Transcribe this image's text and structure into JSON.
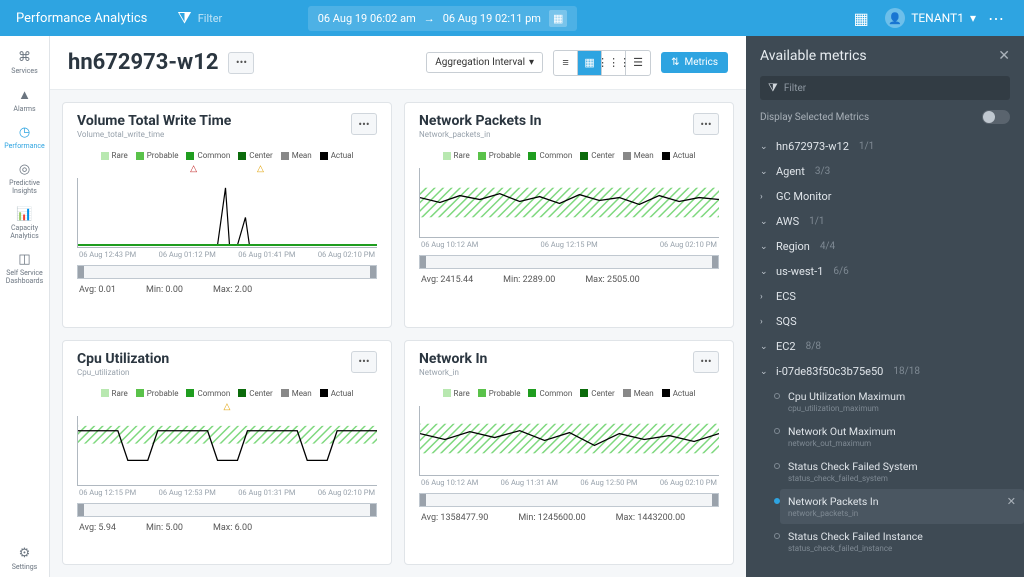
{
  "app": {
    "title": "Performance Analytics"
  },
  "topbar": {
    "filter_placeholder": "Filter",
    "date_from": "06 Aug 19 06:02 am",
    "date_to": "06 Aug 19 02:11 pm",
    "tenant": "TENANT1"
  },
  "sidebar": {
    "items": [
      {
        "label": "Services",
        "icon": "⌘"
      },
      {
        "label": "Alarms",
        "icon": "▲"
      },
      {
        "label": "Performance",
        "icon": "◷",
        "selected": true
      },
      {
        "label": "Predictive Insights",
        "icon": "◎"
      },
      {
        "label": "Capacity Analytics",
        "icon": "📊"
      },
      {
        "label": "Self Service Dashboards",
        "icon": "◫"
      }
    ],
    "settings_label": "Settings"
  },
  "titlebar": {
    "host": "hn672973-w12",
    "agg_label": "Aggregation Interval",
    "metrics_btn": "Metrics"
  },
  "legend": {
    "rare": "Rare",
    "probable": "Probable",
    "common": "Common",
    "center": "Center",
    "mean": "Mean",
    "actual": "Actual"
  },
  "cards": [
    {
      "title": "Volume Total Write Time",
      "subtitle": "Volume_total_write_time",
      "xticks": [
        "06 Aug 12:43 PM",
        "06 Aug 01:12 PM",
        "06 Aug 01:41 PM",
        "06 Aug 02:10 PM"
      ],
      "stats": {
        "avg": "0.01",
        "min": "0.00",
        "max": "2.00"
      },
      "chart_data": {
        "type": "line",
        "xlabel": "",
        "ylabel": "",
        "x": [
          "06 Aug 12:43 PM",
          "06 Aug 01:12 PM",
          "06 Aug 01:41 PM",
          "06 Aug 02:10 PM"
        ],
        "yticks": [
          1,
          2,
          3
        ],
        "series": [
          {
            "name": "Actual",
            "values": [
              0,
              0,
              2,
              0,
              0.9,
              0,
              0,
              0,
              0
            ]
          }
        ]
      }
    },
    {
      "title": "Network Packets In",
      "subtitle": "Network_packets_in",
      "xticks": [
        "06 Aug 10:12 AM",
        "06 Aug 12:15 PM",
        "06 Aug 02:10 PM"
      ],
      "stats": {
        "avg": "2415.44",
        "min": "2289.00",
        "max": "2505.00"
      },
      "chart_data": {
        "type": "line-band",
        "xlabel": "",
        "ylabel": "",
        "x": [
          "06 Aug 10:12 AM",
          "06 Aug 12:15 PM",
          "06 Aug 02:10 PM"
        ],
        "yticks": [
          1880,
          2188,
          2488,
          2014
        ],
        "series": [
          {
            "name": "Actual",
            "values": [
              2450,
              2400,
              2470,
              2430,
              2500,
              2410,
              2440,
              2390,
              2460
            ]
          }
        ]
      }
    },
    {
      "title": "Cpu Utilization",
      "subtitle": "Cpu_utilization",
      "xticks": [
        "06 Aug 12:15 PM",
        "06 Aug 12:53 PM",
        "06 Aug 01:31 PM",
        "06 Aug 02:10 PM"
      ],
      "stats": {
        "avg": "5.94",
        "min": "5.00",
        "max": "6.00"
      },
      "chart_data": {
        "type": "line-band",
        "xlabel": "",
        "ylabel": "",
        "x": [
          "06 Aug 12:15 PM",
          "06 Aug 12:53 PM",
          "06 Aug 01:31 PM",
          "06 Aug 02:10 PM"
        ],
        "yticks": [
          4,
          5,
          5.5,
          6.25
        ],
        "series": [
          {
            "name": "Actual",
            "values": [
              6,
              6,
              5,
              6,
              6,
              5,
              6,
              6,
              5,
              6,
              6,
              6
            ]
          }
        ]
      }
    },
    {
      "title": "Network In",
      "subtitle": "Network_in",
      "xticks": [
        "06 Aug 10:12 AM",
        "06 Aug 11:31 AM",
        "06 Aug 12:50 PM",
        "06 Aug 02:10 PM"
      ],
      "stats": {
        "avg": "1358477.90",
        "min": "1245600.00",
        "max": "1443200.00"
      },
      "chart_data": {
        "type": "line-band",
        "xlabel": "",
        "ylabel": "",
        "x": [
          "06 Aug 10:12 AM",
          "06 Aug 11:31 AM",
          "06 Aug 12:50 PM",
          "06 Aug 02:10 PM"
        ],
        "yticks": [
          918180,
          1168180,
          1418180,
          1775140
        ],
        "series": [
          {
            "name": "Actual",
            "values": [
              1420000,
              1380000,
              1430000,
              1360000,
              1440000,
              1350000,
              1400000,
              1300000,
              1420000
            ]
          }
        ]
      }
    }
  ],
  "rpanel": {
    "title": "Available metrics",
    "filter_placeholder": "Filter",
    "display_selected_label": "Display Selected Metrics",
    "tree": {
      "host": {
        "label": "hn672973-w12",
        "count": "1/1"
      },
      "agent": {
        "label": "Agent",
        "count": "3/3"
      },
      "gc": {
        "label": "GC Monitor"
      },
      "aws": {
        "label": "AWS",
        "count": "1/1"
      },
      "region": {
        "label": "Region",
        "count": "4/4"
      },
      "uswest": {
        "label": "us-west-1",
        "count": "6/6"
      },
      "ecs": {
        "label": "ECS"
      },
      "sqs": {
        "label": "SQS"
      },
      "ec2": {
        "label": "EC2",
        "count": "8/8"
      },
      "instance": {
        "label": "i-07de83f50c3b75e50",
        "count": "18/18"
      }
    },
    "metrics": [
      {
        "name": "Cpu Utilization Maximum",
        "key": "cpu_utilization_maximum"
      },
      {
        "name": "Network Out Maximum",
        "key": "network_out_maximum"
      },
      {
        "name": "Status Check Failed System",
        "key": "status_check_failed_system"
      },
      {
        "name": "Network Packets In",
        "key": "network_packets_in",
        "selected": true
      },
      {
        "name": "Status Check Failed Instance",
        "key": "status_check_failed_instance"
      }
    ]
  },
  "labels": {
    "avg": "Avg:",
    "min": "Min:",
    "max": "Max:"
  }
}
